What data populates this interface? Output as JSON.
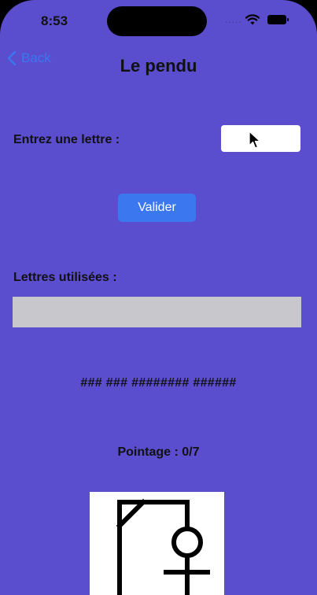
{
  "status_bar": {
    "time": "8:53",
    "dots": "....."
  },
  "nav": {
    "back_label": "Back",
    "title": "Le pendu"
  },
  "form": {
    "letter_label": "Entrez une lettre :",
    "letter_value": "",
    "validate_label": "Valider"
  },
  "used_letters": {
    "label": "Lettres utilisées :",
    "value": ""
  },
  "masked_word": "### ### ######## ######",
  "score": "Pointage : 0/7",
  "colors": {
    "background": "#5a4dce",
    "accent": "#3b78f0",
    "used_box": "#c8c8cc"
  }
}
